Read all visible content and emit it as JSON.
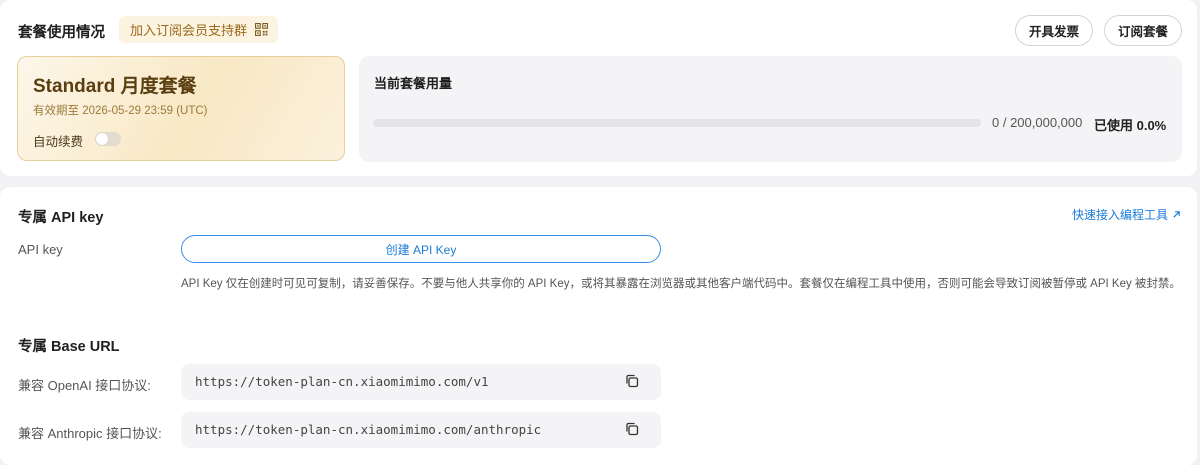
{
  "usage_section": {
    "title": "套餐使用情况",
    "group_badge": "加入订阅会员支持群",
    "invoice_button": "开具发票",
    "subscribe_button": "订阅套餐"
  },
  "plan": {
    "name": "Standard 月度套餐",
    "expiry": "有效期至 2026-05-29 23:59 (UTC)",
    "auto_renew_label": "自动续费",
    "auto_renew_enabled": false
  },
  "usage": {
    "title": "当前套餐用量",
    "count": "0 / 200,000,000",
    "percent": "已使用 0.0%",
    "fraction": 0.0
  },
  "api_key_section": {
    "title": "专属 API key",
    "quick_link": "快速接入编程工具",
    "field_label": "API key",
    "create_button": "创建 API Key",
    "notice": "API Key 仅在创建时可见可复制，请妥善保存。不要与他人共享你的 API Key，或将其暴露在浏览器或其他客户端代码中。套餐仅在编程工具中使用，否则可能会导致订阅被暂停或 API Key 被封禁。"
  },
  "base_url_section": {
    "title": "专属 Base URL",
    "openai_label": "兼容 OpenAI 接口协议:",
    "openai_url": "https://token-plan-cn.xiaomimimo.com/v1",
    "anthropic_label": "兼容 Anthropic 接口协议:",
    "anthropic_url": "https://token-plan-cn.xiaomimimo.com/anthropic"
  },
  "colors": {
    "accent": "#1a7bd6",
    "gold_text": "#9a6a1d",
    "page_bg": "#f2f2f4"
  },
  "icons": [
    "qr-code-icon",
    "arrow-up-right-icon",
    "copy-icon"
  ]
}
